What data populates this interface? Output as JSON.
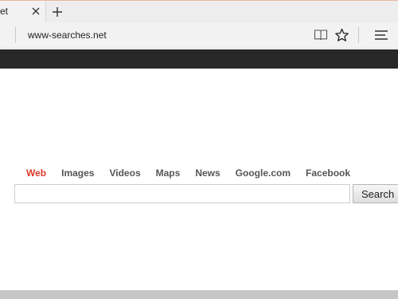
{
  "browser": {
    "tab_title": "et",
    "address": "www-searches.net"
  },
  "search_nav": {
    "links": [
      {
        "label": "Web",
        "active": true
      },
      {
        "label": "Images",
        "active": false
      },
      {
        "label": "Videos",
        "active": false
      },
      {
        "label": "Maps",
        "active": false
      },
      {
        "label": "News",
        "active": false
      },
      {
        "label": "Google.com",
        "active": false
      },
      {
        "label": "Facebook",
        "active": false
      }
    ]
  },
  "search": {
    "input_value": "",
    "button_label": "Search"
  },
  "colors": {
    "active_link": "#dd3b2a",
    "dark_bar": "#282828"
  }
}
